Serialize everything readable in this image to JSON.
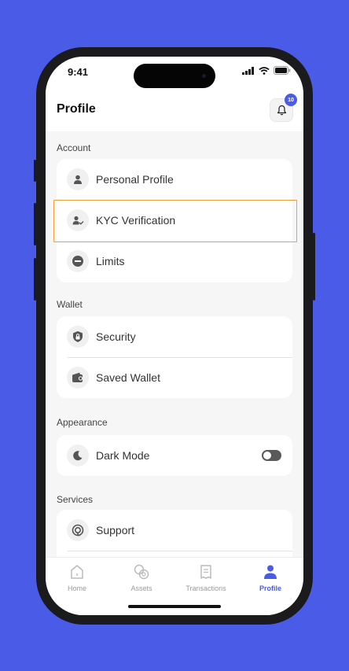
{
  "status_bar": {
    "time": "9:41"
  },
  "header": {
    "title": "Profile",
    "notification_count": "10"
  },
  "sections": [
    {
      "label": "Account",
      "items": [
        {
          "label": "Personal Profile",
          "icon": "person-icon"
        },
        {
          "label": "KYC Verification",
          "icon": "person-check-icon"
        },
        {
          "label": "Limits",
          "icon": "minus-circle-icon"
        }
      ]
    },
    {
      "label": "Wallet",
      "items": [
        {
          "label": "Security",
          "icon": "shield-lock-icon"
        },
        {
          "label": "Saved Wallet",
          "icon": "wallet-icon"
        }
      ]
    },
    {
      "label": "Appearance",
      "items": [
        {
          "label": "Dark Mode",
          "icon": "moon-icon",
          "toggle_on": false
        }
      ]
    },
    {
      "label": "Services",
      "items": [
        {
          "label": "Support",
          "icon": "support-icon"
        }
      ]
    }
  ],
  "tabs": [
    {
      "label": "Home",
      "icon": "home-icon",
      "active": false
    },
    {
      "label": "Assets",
      "icon": "assets-icon",
      "active": false
    },
    {
      "label": "Transactions",
      "icon": "receipt-icon",
      "active": false
    },
    {
      "label": "Profile",
      "icon": "profile-icon",
      "active": true
    }
  ],
  "colors": {
    "background": "#4a5be8",
    "accent": "#4a5be8",
    "highlight": "#f0a03a"
  }
}
